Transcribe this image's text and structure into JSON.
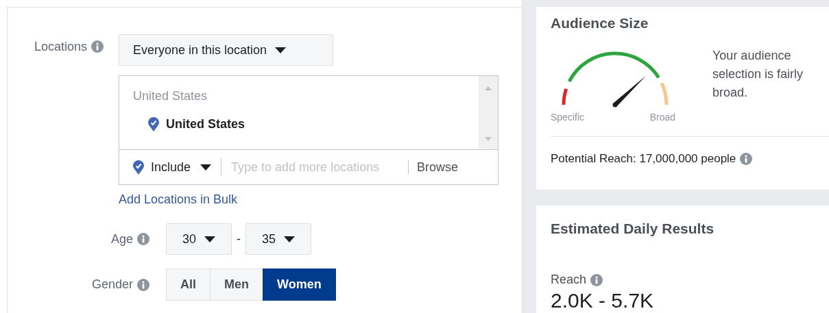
{
  "locations": {
    "label": "Locations",
    "mode": "Everyone in this location",
    "list_header": "United States",
    "items": [
      {
        "name": "United States"
      }
    ],
    "include": "Include",
    "search": {
      "placeholder": "Type to add more locations"
    },
    "browse": "Browse",
    "bulk_link": "Add Locations in Bulk"
  },
  "age": {
    "label": "Age",
    "min": "30",
    "separator": "-",
    "max": "35"
  },
  "gender": {
    "label": "Gender",
    "options": [
      {
        "label": "All",
        "selected": false
      },
      {
        "label": "Men",
        "selected": false
      },
      {
        "label": "Women",
        "selected": true
      }
    ]
  },
  "audience_size": {
    "title": "Audience Size",
    "meter": {
      "low_label": "Specific",
      "high_label": "Broad"
    },
    "description": "Your audience selection is fairly broad.",
    "potential_reach": "Potential Reach: 17,000,000 people"
  },
  "daily_results": {
    "title": "Estimated Daily Results",
    "metrics": [
      {
        "label": "Reach",
        "value": "2.0K - 5.7K"
      }
    ]
  }
}
